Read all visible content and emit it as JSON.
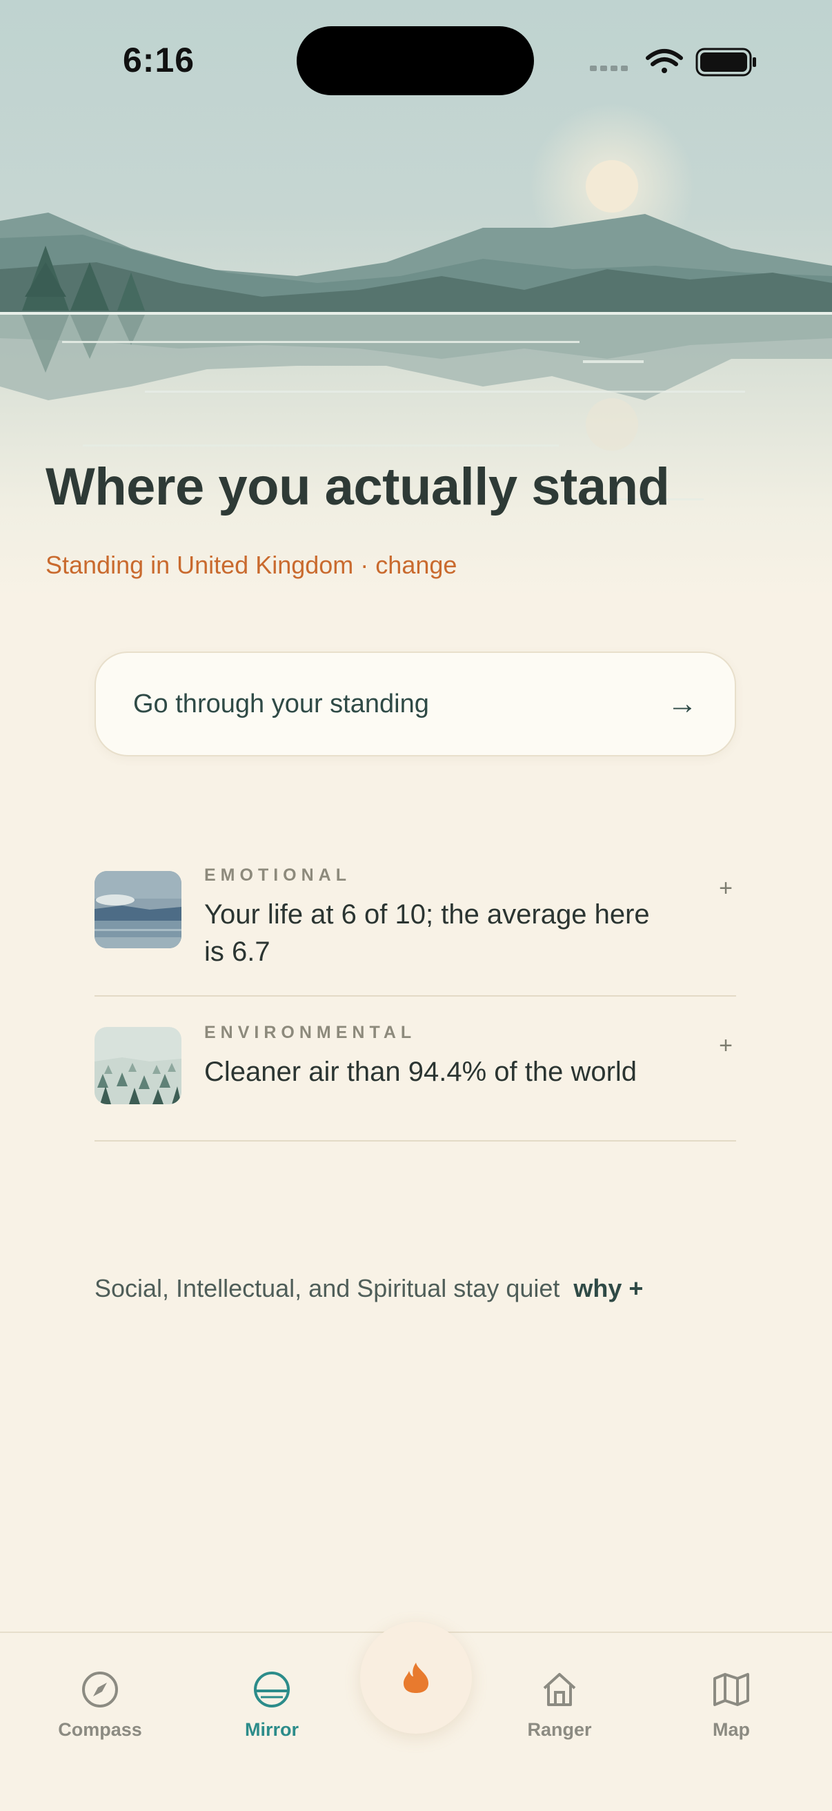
{
  "status_bar": {
    "time": "6:16"
  },
  "header": {
    "title": "Where you actually stand",
    "location_prefix": "Standing in United Kingdom",
    "location_separator": " · ",
    "location_action": "change"
  },
  "cta": {
    "label": "Go through your standing",
    "arrow": "→"
  },
  "standings": [
    {
      "category": "EMOTIONAL",
      "statement": "Your life at 6 of 10; the average here is 6.7",
      "expand": "+",
      "thumbnail": "lake-landscape"
    },
    {
      "category": "ENVIRONMENTAL",
      "statement": "Cleaner air than 94.4% of the world",
      "expand": "+",
      "thumbnail": "pine-forest"
    }
  ],
  "quiet_note": {
    "text": "Social, Intellectual, and Spiritual stay quiet",
    "link": "why +"
  },
  "tab_bar": {
    "tabs": [
      {
        "label": "Compass",
        "icon": "compass-icon",
        "active": false
      },
      {
        "label": "Mirror",
        "icon": "mirror-icon",
        "active": true
      },
      {
        "label": "Ranger",
        "icon": "home-icon",
        "active": false
      },
      {
        "label": "Map",
        "icon": "map-icon",
        "active": false
      }
    ],
    "center_button_icon": "flame-icon"
  },
  "colors": {
    "accent": "#c96a2e",
    "active_tab": "#2c8c8a",
    "text": "#2e3a36",
    "background": "#f8f2e6"
  }
}
